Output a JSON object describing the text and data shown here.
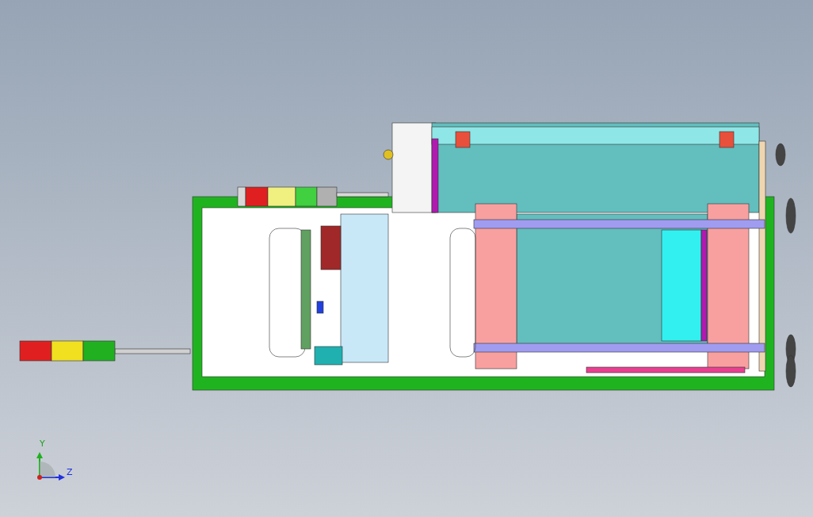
{
  "viewport": {
    "triad": {
      "labels": [
        {
          "kind": "y",
          "text": "Y"
        },
        {
          "kind": "z",
          "text": "Z"
        }
      ]
    }
  }
}
